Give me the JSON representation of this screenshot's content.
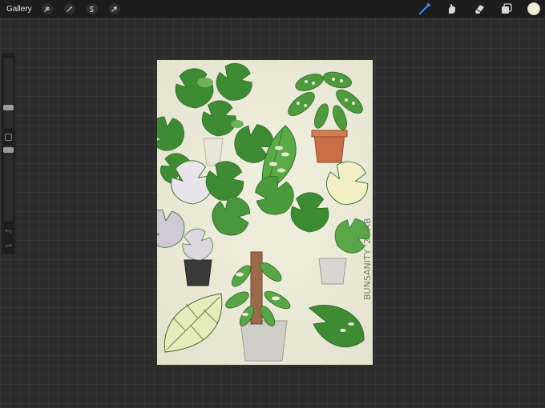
{
  "toolbar": {
    "gallery_label": "Gallery",
    "left_icons": [
      "wrench-icon",
      "magic-wand-icon",
      "selection-icon",
      "transform-arrow-icon"
    ],
    "right_icons": [
      "brush-icon",
      "smudge-icon",
      "eraser-icon",
      "layers-icon"
    ],
    "active_tool": "brush",
    "active_color": "#f1f0d8",
    "brush_accent": "#3f8cff"
  },
  "sidebar": {
    "brush_size_level": 0.35,
    "opacity_level": 0.3
  },
  "canvas": {
    "artwork": "monstera plants sticker sheet",
    "signature": "BUNSANITY '21·AB"
  }
}
